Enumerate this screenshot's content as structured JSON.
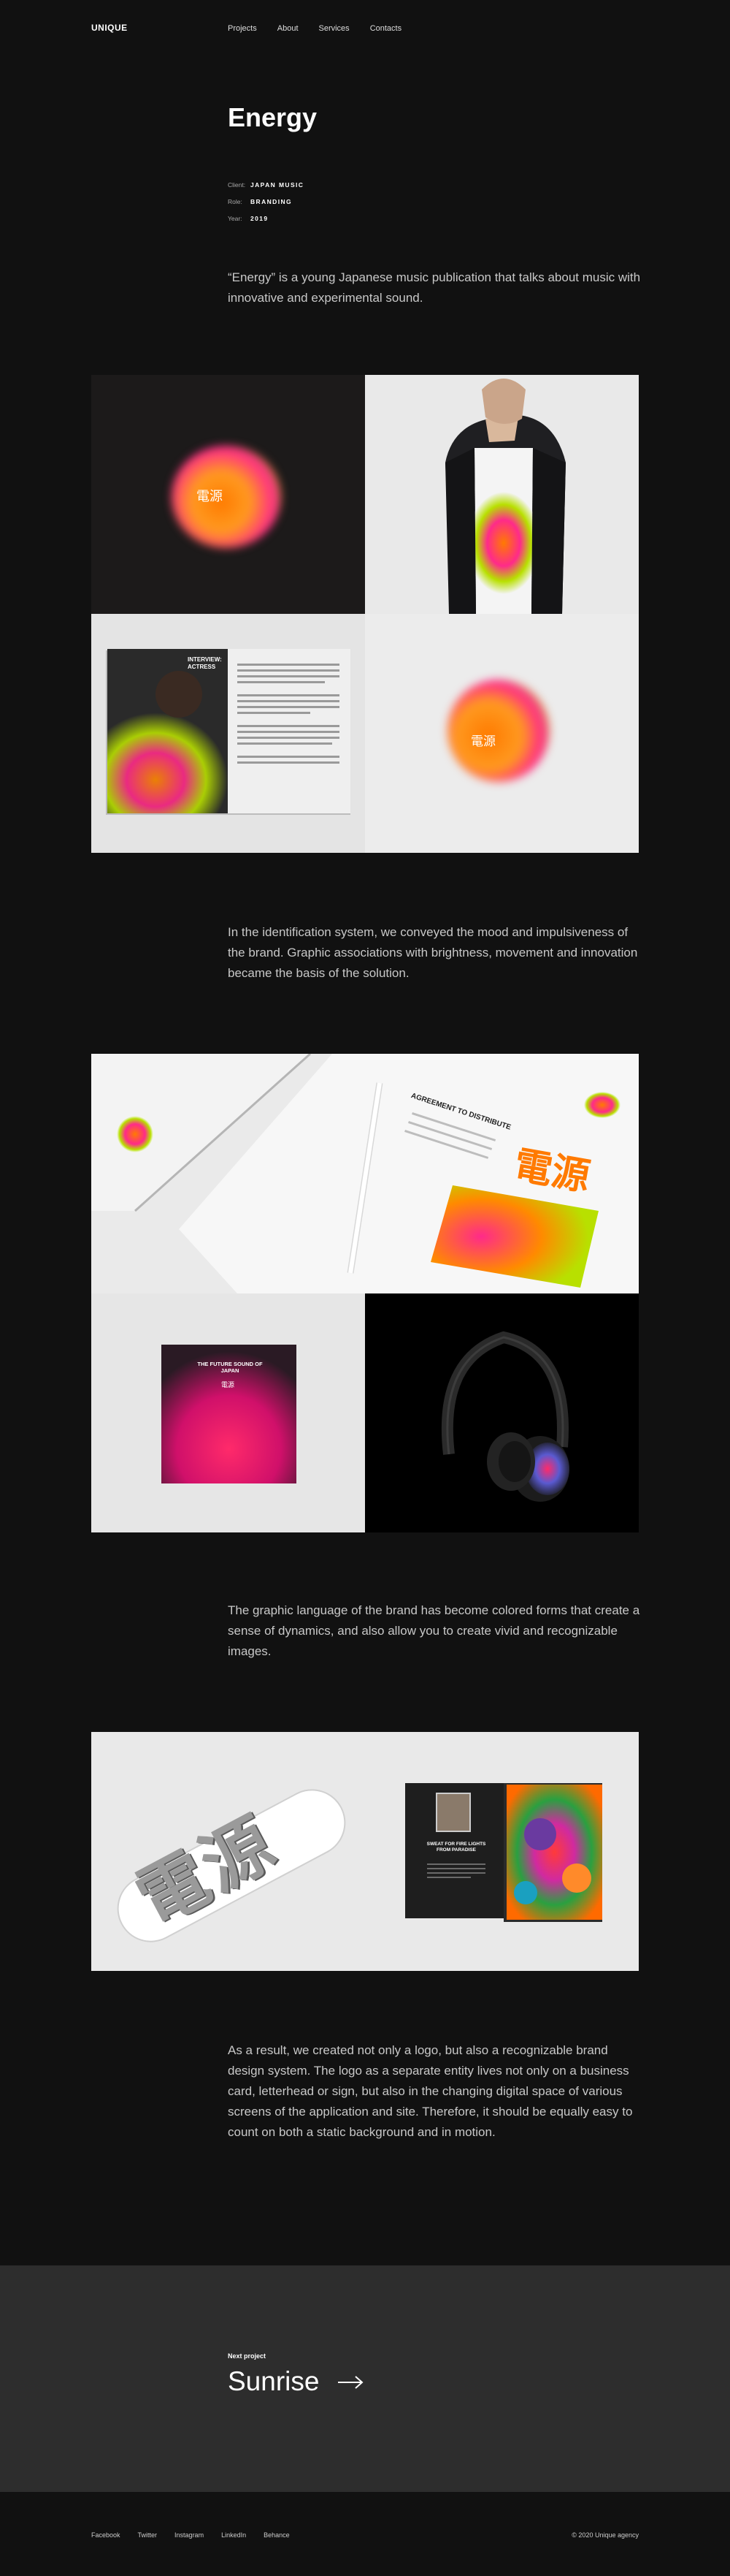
{
  "header": {
    "logo": "UNIQUE",
    "nav": [
      "Projects",
      "About",
      "Services",
      "Contacts"
    ]
  },
  "project": {
    "title": "Energy",
    "meta": [
      {
        "key": "Client:",
        "value": "JAPAN MUSIC"
      },
      {
        "key": "Role:",
        "value": "BRANDING"
      },
      {
        "key": "Year:",
        "value": "2019"
      }
    ],
    "intro": "“Energy” is a young Japanese music publication that talks about music with innovative and experimental sound.",
    "paragraph_2": "In the identification system, we conveyed the mood and impulsiveness of the brand. Graphic associations with brightness, movement and innovation became the basis of the solution.",
    "paragraph_3": "The graphic language of the brand has become colored forms that create a sense of dynamics, and also allow you to create vivid and recognizable images.",
    "paragraph_4": "As a result, we created not only a logo, but also a recognizable brand design system. The logo as a separate entity lives not only on a business card, letterhead or sign, but also in the changing digital space of various screens of the application and site. Therefore, it should be equally easy to count on both a static background and in motion."
  },
  "images": {
    "logo_kanji": "電源",
    "magazine_heading": "INTERVIEW: ACTRESS",
    "agreement_title": "AGREEMENT TO DISTRIBUTE",
    "vinyl_title": "THE FUTURE SOUND OF JAPAN",
    "book_title": "SWEAT FOR FIRE LIGHTS FROM PARADISE"
  },
  "next_project": {
    "label": "Next project",
    "title": "Sunrise"
  },
  "footer": {
    "socials": [
      "Facebook",
      "Twitter",
      "Instagram",
      "LinkedIn",
      "Behance"
    ],
    "copyright": "© 2020 Unique agency"
  },
  "colors": {
    "background": "#111111",
    "next_section": "#2d2d2d",
    "blob_orange": "#ff8a00",
    "blob_pink": "#ff2a8a",
    "blob_green": "#b8e000"
  }
}
